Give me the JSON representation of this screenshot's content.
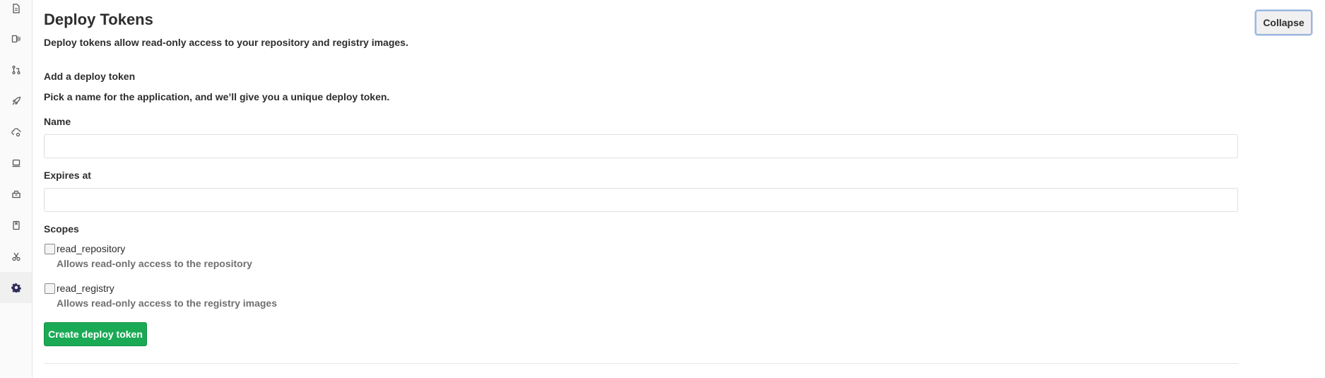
{
  "sidebar": {
    "items": [
      {
        "icon": "file-icon"
      },
      {
        "icon": "issues-icon"
      },
      {
        "icon": "merge-request-icon"
      },
      {
        "icon": "rocket-icon"
      },
      {
        "icon": "cloud-gear-icon"
      },
      {
        "icon": "monitor-icon"
      },
      {
        "icon": "package-icon"
      },
      {
        "icon": "book-icon"
      },
      {
        "icon": "scissors-icon"
      },
      {
        "icon": "settings-icon"
      }
    ],
    "active_icon": "settings-icon",
    "active_color": "#2e2e5a"
  },
  "section": {
    "title": "Deploy Tokens",
    "description": "Deploy tokens allow read-only access to your repository and registry images.",
    "collapse_label": "Collapse"
  },
  "form": {
    "subtitle": "Add a deploy token",
    "subdescription": "Pick a name for the application, and we’ll give you a unique deploy token.",
    "name_label": "Name",
    "name_value": "",
    "expires_label": "Expires at",
    "expires_value": "",
    "scopes_label": "Scopes",
    "scopes": [
      {
        "name": "read_repository",
        "help": "Allows read-only access to the repository",
        "checked": false
      },
      {
        "name": "read_registry",
        "help": "Allows read-only access to the registry images",
        "checked": false
      }
    ],
    "submit_label": "Create deploy token"
  },
  "colors": {
    "primary_button": "#1aaa55",
    "text": "#2e2e2e",
    "muted_text": "#707070"
  }
}
